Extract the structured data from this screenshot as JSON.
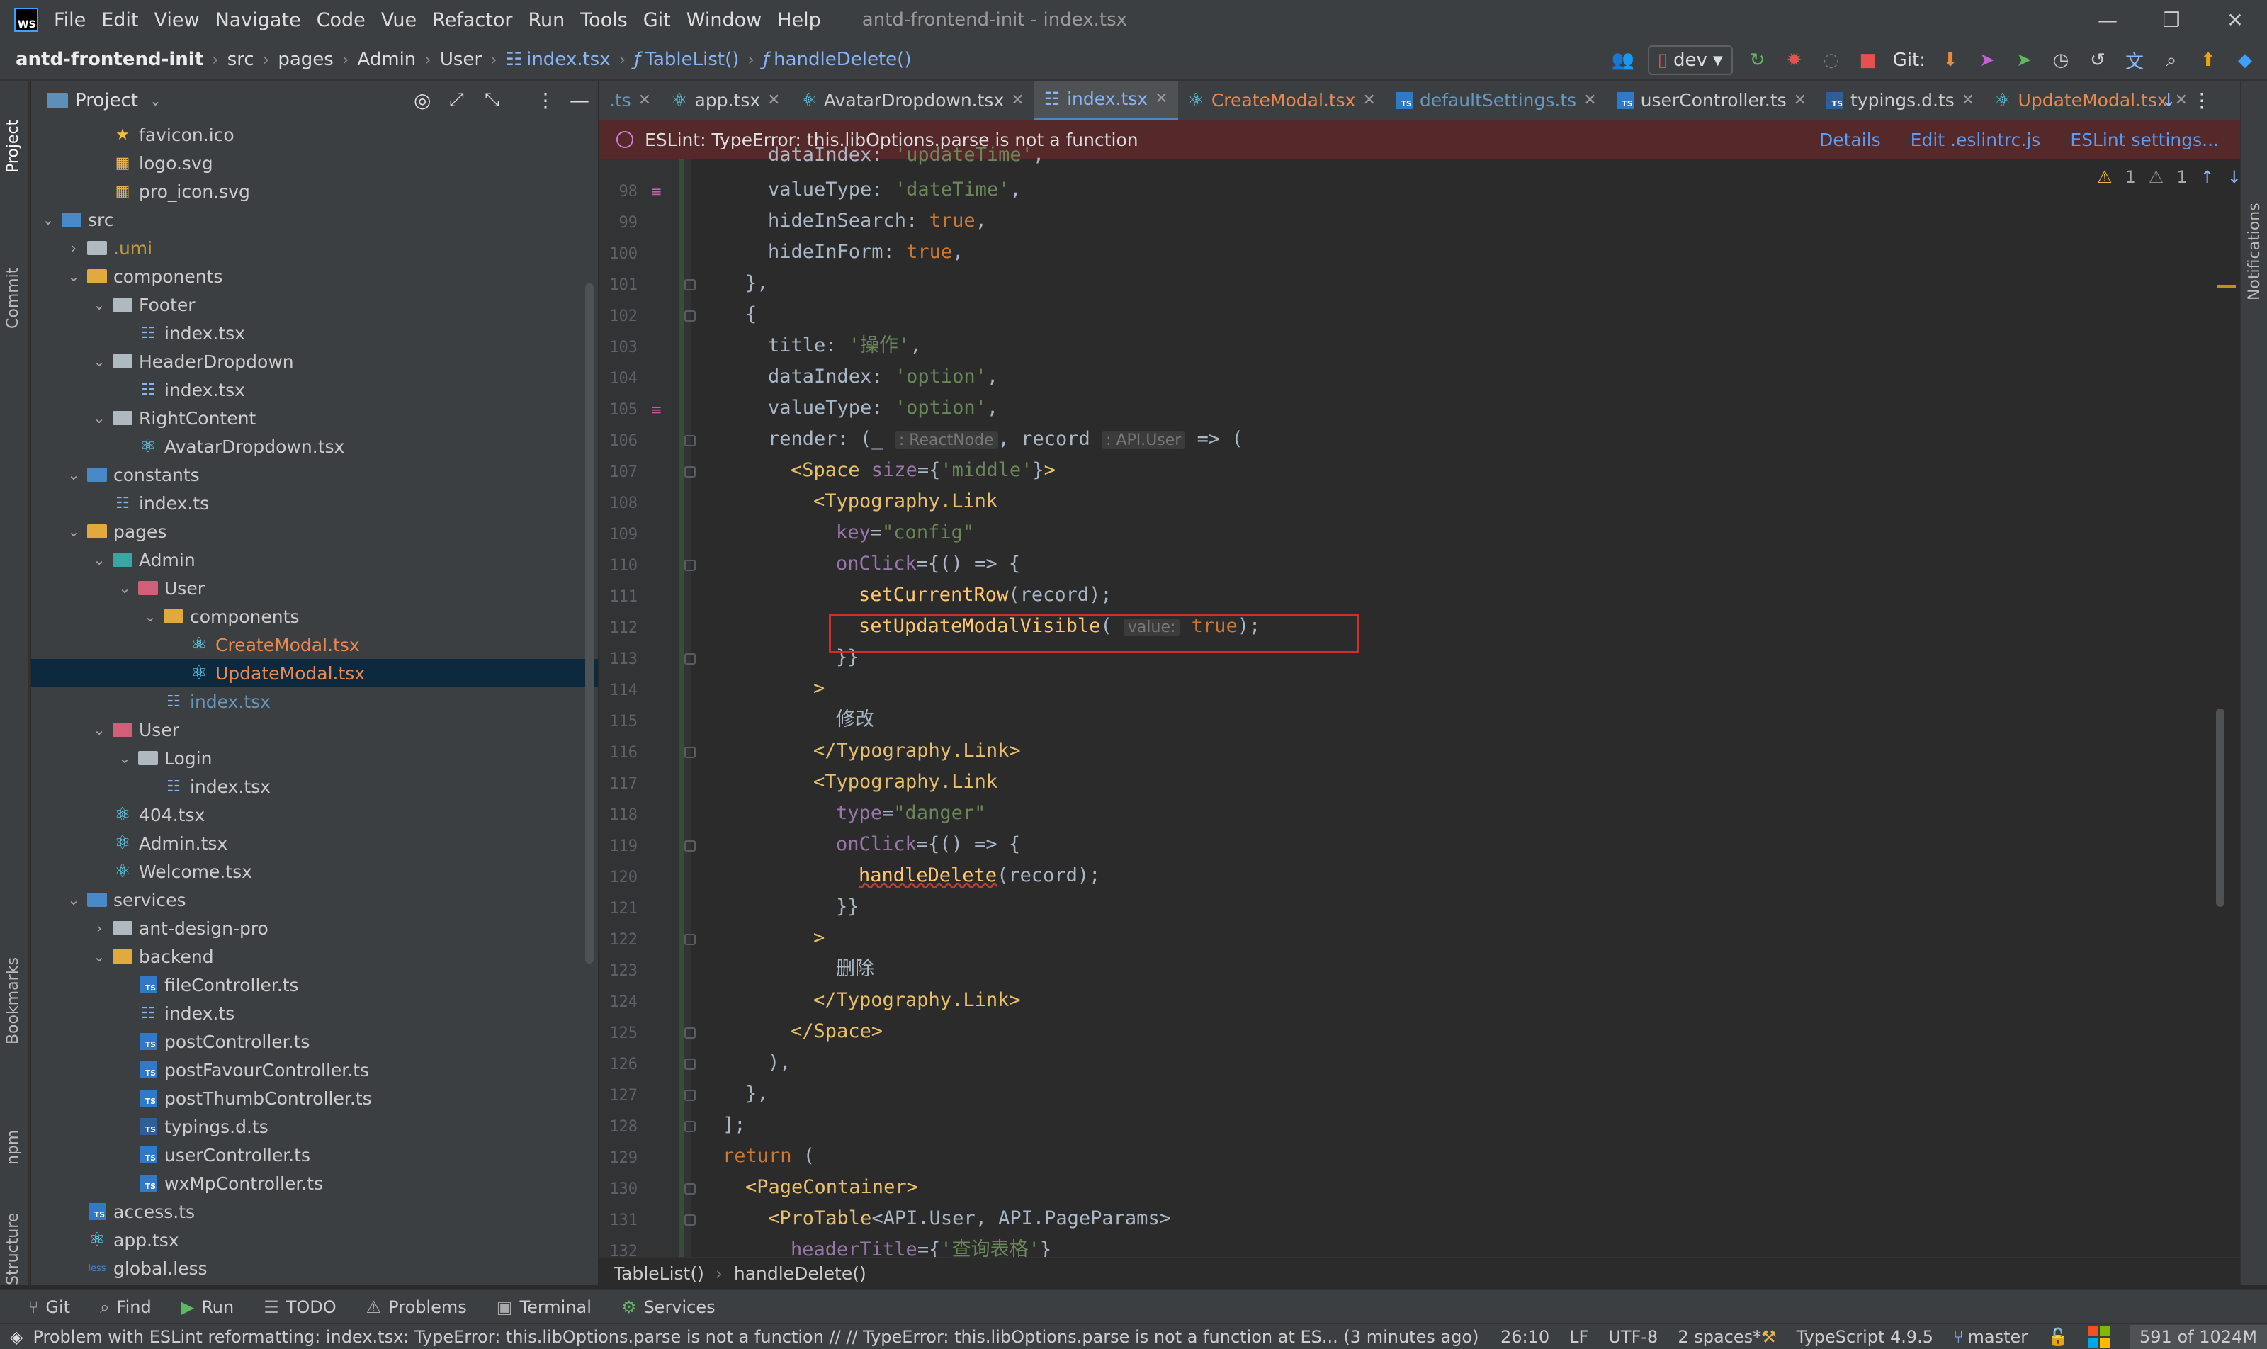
{
  "menubar": {
    "items": [
      "File",
      "Edit",
      "View",
      "Navigate",
      "Code",
      "Vue",
      "Refactor",
      "Run",
      "Tools",
      "Git",
      "Window",
      "Help"
    ],
    "window_title": "antd-frontend-init - index.tsx"
  },
  "navbar": {
    "crumbs": [
      "antd-frontend-init",
      "src",
      "pages",
      "Admin",
      "User",
      "index.tsx",
      "TableList()",
      "handleDelete()"
    ],
    "run_config": "dev",
    "git_label": "Git:"
  },
  "leftstrip": {
    "project": "Project",
    "commit": "Commit",
    "bookmarks": "Bookmarks",
    "npm": "npm",
    "structure": "Structure"
  },
  "rightstrip": {
    "notifications": "Notifications"
  },
  "project": {
    "title": "Project",
    "rows": [
      {
        "label": "favicon.ico",
        "indent": 3
      },
      {
        "label": "logo.svg",
        "indent": 3
      },
      {
        "label": "pro_icon.svg",
        "indent": 3
      },
      {
        "label": "src",
        "indent": 1
      },
      {
        "label": ".umi",
        "indent": 2
      },
      {
        "label": "components",
        "indent": 2
      },
      {
        "label": "Footer",
        "indent": 3
      },
      {
        "label": "index.tsx",
        "indent": 4
      },
      {
        "label": "HeaderDropdown",
        "indent": 3
      },
      {
        "label": "index.tsx",
        "indent": 4
      },
      {
        "label": "RightContent",
        "indent": 3
      },
      {
        "label": "AvatarDropdown.tsx",
        "indent": 4
      },
      {
        "label": "constants",
        "indent": 2
      },
      {
        "label": "index.ts",
        "indent": 3
      },
      {
        "label": "pages",
        "indent": 2
      },
      {
        "label": "Admin",
        "indent": 3
      },
      {
        "label": "User",
        "indent": 4
      },
      {
        "label": "components",
        "indent": 5
      },
      {
        "label": "CreateModal.tsx",
        "indent": 6
      },
      {
        "label": "UpdateModal.tsx",
        "indent": 6
      },
      {
        "label": "index.tsx",
        "indent": 5
      },
      {
        "label": "User",
        "indent": 3
      },
      {
        "label": "Login",
        "indent": 4
      },
      {
        "label": "index.tsx",
        "indent": 5
      },
      {
        "label": "404.tsx",
        "indent": 3
      },
      {
        "label": "Admin.tsx",
        "indent": 3
      },
      {
        "label": "Welcome.tsx",
        "indent": 3
      },
      {
        "label": "services",
        "indent": 2
      },
      {
        "label": "ant-design-pro",
        "indent": 3
      },
      {
        "label": "backend",
        "indent": 3
      },
      {
        "label": "fileController.ts",
        "indent": 4
      },
      {
        "label": "index.ts",
        "indent": 4
      },
      {
        "label": "postController.ts",
        "indent": 4
      },
      {
        "label": "postFavourController.ts",
        "indent": 4
      },
      {
        "label": "postThumbController.ts",
        "indent": 4
      },
      {
        "label": "typings.d.ts",
        "indent": 4
      },
      {
        "label": "userController.ts",
        "indent": 4
      },
      {
        "label": "wxMpController.ts",
        "indent": 4
      },
      {
        "label": "access.ts",
        "indent": 2
      },
      {
        "label": "app.tsx",
        "indent": 2
      },
      {
        "label": "global.less",
        "indent": 2
      }
    ]
  },
  "tabs": [
    ".ts",
    "app.tsx",
    "AvatarDropdown.tsx",
    "index.tsx",
    "CreateModal.tsx",
    "defaultSettings.ts",
    "userController.ts",
    "typings.d.ts",
    "UpdateModal.tsx"
  ],
  "active_tab": "index.tsx",
  "eslint": {
    "message": "ESLint: TypeError: this.libOptions.parse is not a function",
    "details": "Details",
    "edit": "Edit .eslintrc.js",
    "settings": "ESLint settings..."
  },
  "inspection": {
    "warnings": "1",
    "weak": "1"
  },
  "line_numbers": [
    "98",
    "99",
    "100",
    "101",
    "102",
    "103",
    "104",
    "105",
    "106",
    "107",
    "108",
    "109",
    "110",
    "111",
    "112",
    "113",
    "114",
    "115",
    "116",
    "117",
    "118",
    "119",
    "120",
    "121",
    "122",
    "123",
    "124",
    "125",
    "126",
    "127",
    "128",
    "129",
    "130",
    "131",
    "132"
  ],
  "code": {
    "l97_value": "'updateTime'",
    "l98_value": "'dateTime'",
    "l103_title": "'操作'",
    "l104_value": "'option'",
    "l105_value": "'option'",
    "hint_reactnode": ": ReactNode",
    "hint_apiuser": ": API.User",
    "l107_size": "'middle'",
    "l109_key": "\"config\"",
    "hint_value": "value:",
    "l115_text": "修改",
    "l118_type": "\"danger\"",
    "l123_text": "删除",
    "l132_title": "'查询表格'"
  },
  "breadcrumb_bottom": [
    "TableList()",
    "handleDelete()"
  ],
  "toolbar": [
    "Git",
    "Find",
    "Run",
    "TODO",
    "Problems",
    "Terminal",
    "Services"
  ],
  "status": {
    "message": "Problem with ESLint reformatting: index.tsx: TypeError: this.libOptions.parse is not a function // // TypeError: this.libOptions.parse is not a function     at ES... (3 minutes ago)",
    "position": "26:10",
    "line_sep": "LF",
    "encoding": "UTF-8",
    "indent": "2 spaces*",
    "language": "TypeScript 4.9.5",
    "branch": "master",
    "memory": "591 of 1024M"
  }
}
